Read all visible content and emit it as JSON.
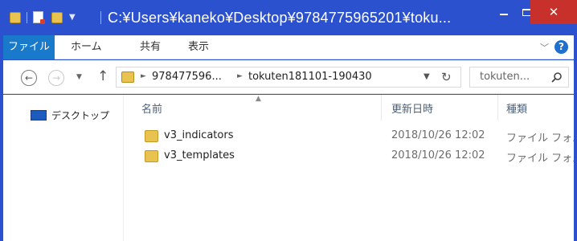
{
  "window": {
    "title": "C:¥Users¥kaneko¥Desktop¥9784775965201¥toku...",
    "accent": "#2b51cf",
    "close_color": "#c7302b"
  },
  "ribbon": {
    "tabs": [
      {
        "label": "ファイル"
      },
      {
        "label": "ホーム"
      },
      {
        "label": "共有"
      },
      {
        "label": "表示"
      }
    ]
  },
  "address": {
    "crumbs": [
      "978477596...",
      "tokuten181101-190430"
    ]
  },
  "search": {
    "placeholder": "tokuten..."
  },
  "navpane": {
    "items": [
      {
        "label": "デスクトップ",
        "icon": "desktop-icon"
      }
    ]
  },
  "columns": {
    "name": "名前",
    "date": "更新日時",
    "type": "種類"
  },
  "files": [
    {
      "name": "v3_indicators",
      "date": "2018/10/26 12:02",
      "type": "ファイル フォルダー",
      "icon": "folder-icon"
    },
    {
      "name": "v3_templates",
      "date": "2018/10/26 12:02",
      "type": "ファイル フォルダー",
      "icon": "folder-icon"
    }
  ]
}
